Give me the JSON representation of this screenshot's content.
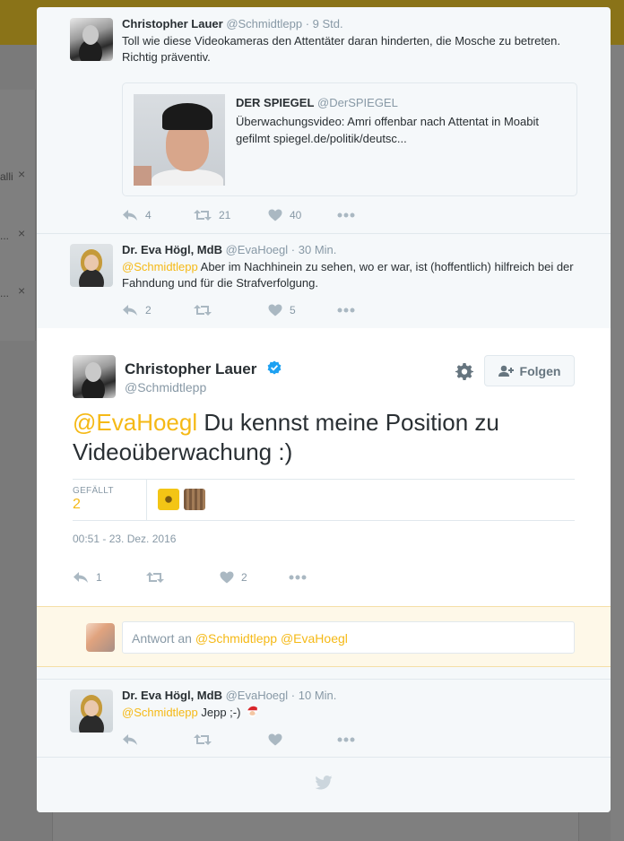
{
  "background": {
    "snippets": [
      "alli",
      "...",
      "..."
    ],
    "close_glyph": "×"
  },
  "tweets": [
    {
      "author_name": "Christopher Lauer",
      "author_handle": "@Schmidtlepp",
      "dot": "·",
      "time": "9 Std.",
      "text": "Toll wie diese Videokameras den Attentäter daran hinderten, die Mosche zu betreten. Richtig präventiv.",
      "quote": {
        "author_name": "DER SPIEGEL",
        "author_handle": "@DerSPIEGEL",
        "text": "Überwachungsvideo: Amri offenbar nach Attentat in Moabit gefilmt spiegel.de/politik/deutsc..."
      },
      "reply_count": "4",
      "retweet_count": "21",
      "like_count": "40"
    },
    {
      "author_name": "Dr. Eva Högl, MdB",
      "author_handle": "@EvaHoegl",
      "dot": "·",
      "time": "30 Min.",
      "mention": "@Schmidtlepp",
      "text": "Aber im Nachhinein zu sehen, wo er war, ist (hoffentlich) hilfreich bei der Fahndung und für die Strafverfolgung.",
      "reply_count": "2",
      "retweet_count": "",
      "like_count": "5"
    }
  ],
  "main_tweet": {
    "author_name": "Christopher Lauer",
    "author_handle": "@Schmidtlepp",
    "follow_label": "Folgen",
    "mention": "@EvaHoegl",
    "text": "Du kennst meine Position zu Videoüberwachung :)",
    "likes_label": "GEFÄLLT",
    "likes_value": "2",
    "timestamp": "00:51 - 23. Dez. 2016",
    "reply_count": "1",
    "retweet_count": "",
    "like_count": "2"
  },
  "reply_box": {
    "prefix": "Antwort an",
    "mentions": "@Schmidtlepp @EvaHoegl"
  },
  "last_reply": {
    "author_name": "Dr. Eva Högl, MdB",
    "author_handle": "@EvaHoegl",
    "dot": "·",
    "time": "10 Min.",
    "mention": "@Schmidtlepp",
    "text": "Jepp ;-)",
    "reply_count": "",
    "retweet_count": "",
    "like_count": ""
  },
  "colors": {
    "accent": "#f5b916",
    "verified": "#1da1f2",
    "muted": "#8899a6"
  },
  "icons": [
    "reply-icon",
    "retweet-icon",
    "heart-icon",
    "more-icon",
    "gear-icon",
    "follow-person-icon",
    "verified-icon",
    "santa-emoji-icon",
    "twitter-bird-icon"
  ]
}
